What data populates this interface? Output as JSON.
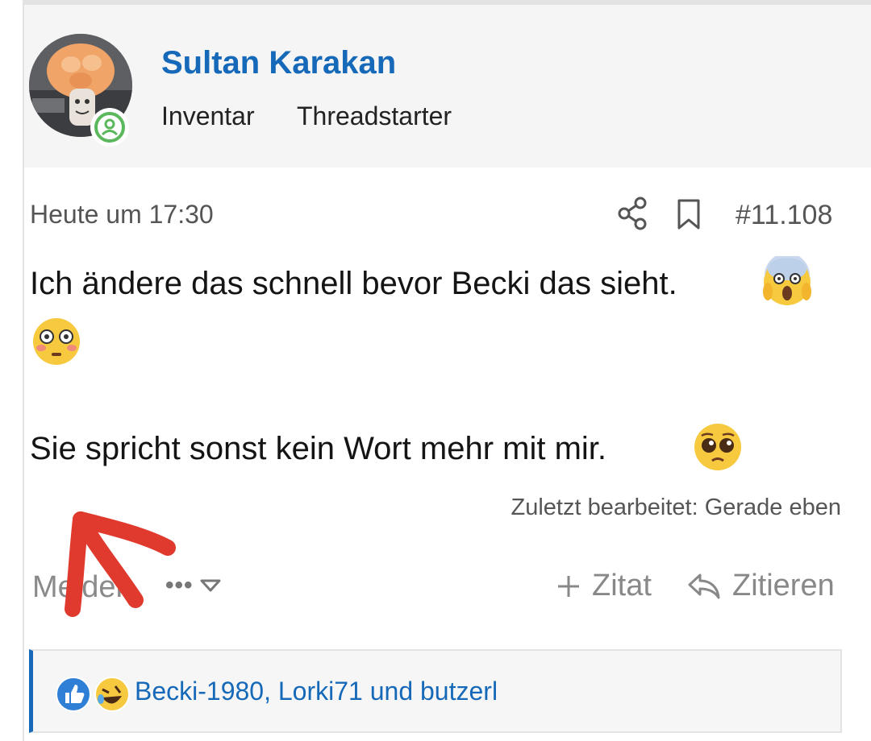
{
  "post": {
    "author": {
      "name": "Sultan Karakan",
      "title": "Inventar",
      "badge": "Threadstarter"
    },
    "date": "Heute um 17:30",
    "number": "#11.108",
    "body": {
      "line1": "Ich ändere das schnell bevor Becki das sieht.",
      "line3": "Sie spricht sonst kein Wort mehr mit mir."
    },
    "emojis": [
      "face-screaming-in-fear",
      "flushed-face",
      "pleading-face"
    ],
    "edited_note": "Zuletzt bearbeitet: Gerade eben",
    "actions": {
      "report": "Melden",
      "more": "•••",
      "zitat": "Zitat",
      "zitieren": "Zitieren"
    },
    "reactions": {
      "icons": [
        "like-icon",
        "laughing-icon"
      ],
      "users": "Becki-1980, Lorki71 und butzerl"
    }
  },
  "colors": {
    "accent": "#1569b8",
    "header_bg": "#f5f5f5",
    "online": "#5cb85c",
    "annotation": "#e03a2f"
  }
}
